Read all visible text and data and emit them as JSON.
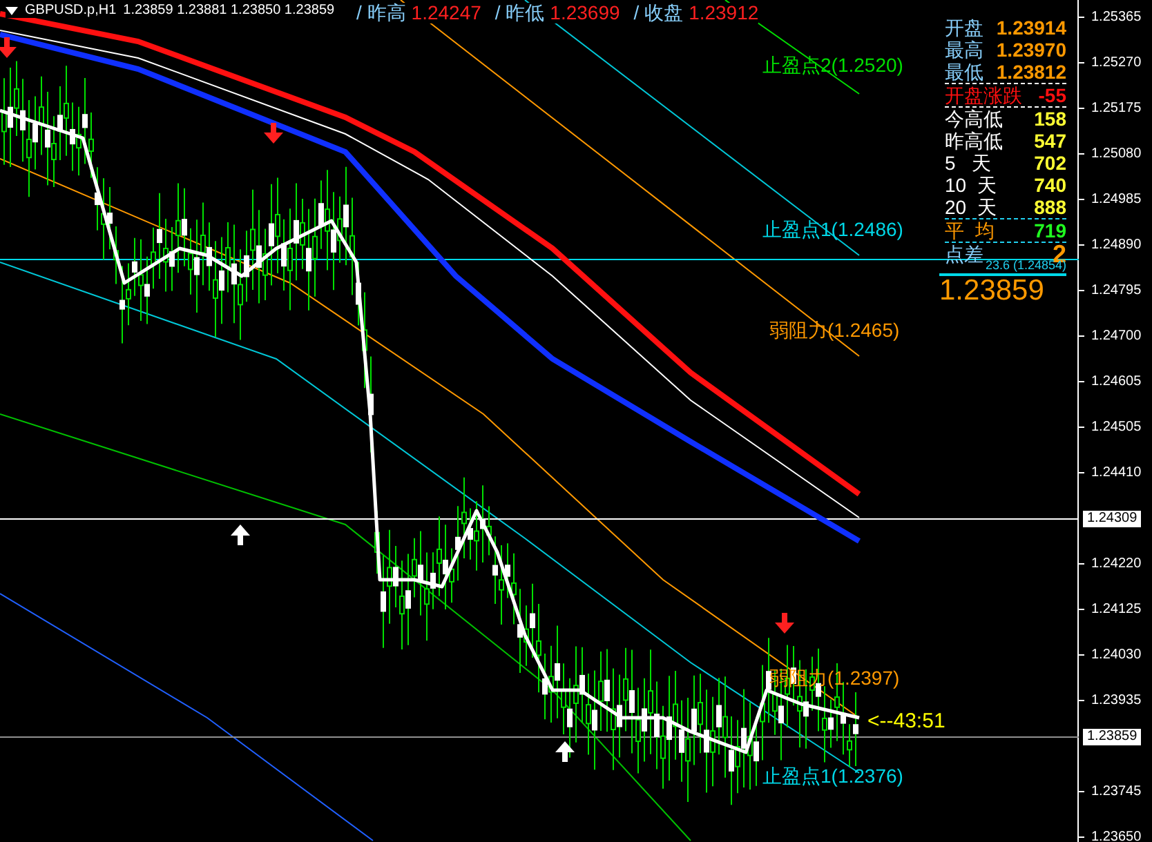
{
  "chart_header": {
    "symbol": "GBPUSD.p,H1",
    "ohlc": "1.23859 1.23881 1.23850 1.23859"
  },
  "previous_day": [
    {
      "label": "/ 昨高",
      "value": "1.24247"
    },
    {
      "label": "/ 昨低",
      "value": "1.23699"
    },
    {
      "label": "/ 收盘",
      "value": "1.23912"
    }
  ],
  "info_panel": {
    "rows": [
      {
        "kind": "price",
        "label": "开盘",
        "value": "1.23914"
      },
      {
        "kind": "price",
        "label": "最高",
        "value": "1.23970"
      },
      {
        "kind": "price",
        "label": "最低",
        "value": "1.23812"
      },
      {
        "kind": "change",
        "label": "开盘涨跌",
        "value": "-55"
      },
      {
        "kind": "range",
        "label": "今高低",
        "value": "158"
      },
      {
        "kind": "range",
        "label": "昨高低",
        "value": "547"
      },
      {
        "kind": "range",
        "label": "5   天",
        "value": "702"
      },
      {
        "kind": "range",
        "label": "10  天",
        "value": "740"
      },
      {
        "kind": "range",
        "label": "20  天",
        "value": "888"
      },
      {
        "kind": "average",
        "label": "平  均",
        "value": "719"
      },
      {
        "kind": "spread",
        "label": "点差",
        "value": "2"
      }
    ],
    "spread_note": "23.6 (1.24854)",
    "current_price": "1.23859"
  },
  "levels": [
    {
      "label": "止盈点2(1.2520)",
      "color": "#00e000"
    },
    {
      "label": "止盈点1(1.2486)",
      "color": "#00d8e8"
    },
    {
      "label": "弱阻力(1.2465)",
      "color": "#ff9900"
    },
    {
      "label": "弱阻力(1.2397)",
      "color": "#ff9900"
    },
    {
      "label": "止盈点1(1.2376)",
      "color": "#00d8e8"
    }
  ],
  "countdown": "<--43:51",
  "price_axis": {
    "ticks": [
      "1.25365",
      "1.25270",
      "1.25175",
      "1.25080",
      "1.24985",
      "1.24890",
      "1.24795",
      "1.24700",
      "1.24605",
      "1.24505",
      "1.24410",
      "1.24220",
      "1.24125",
      "1.24030",
      "1.23935",
      "1.23745",
      "1.23650"
    ],
    "markers": [
      "1.24309",
      "1.23859"
    ]
  }
}
